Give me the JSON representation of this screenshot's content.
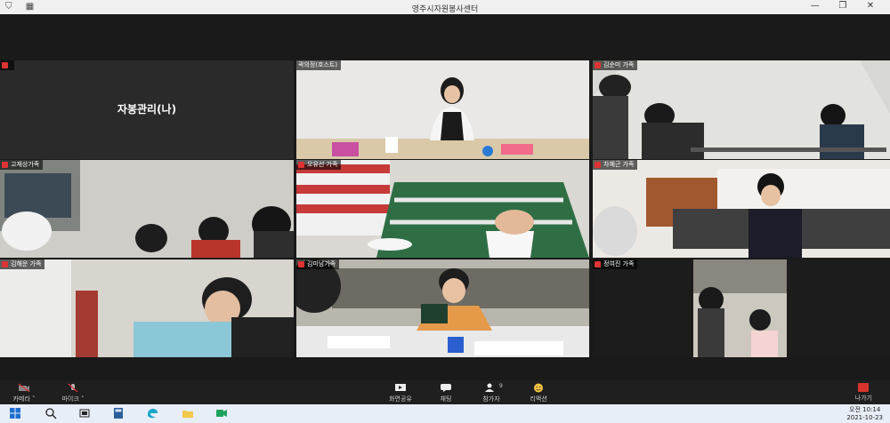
{
  "window": {
    "title": "영주시자원봉사센터"
  },
  "self_tile": {
    "name": "자봉관리(나)"
  },
  "participants": [
    {
      "name": "곽의정(호스트)"
    },
    {
      "name": "김순미 가족"
    },
    {
      "name": "고재상가족"
    },
    {
      "name": "오유선 가족"
    },
    {
      "name": "차혜근 가족"
    },
    {
      "name": "김해운 가족"
    },
    {
      "name": "김미남가족"
    },
    {
      "name": "정여진 가족"
    }
  ],
  "toolbar": {
    "camera_label": "카메라",
    "mic_label": "마이크",
    "share_label": "화면공유",
    "chat_label": "채팅",
    "participants_label": "참가자",
    "participants_count": "9",
    "reaction_label": "리액션",
    "leave_label": "나가기"
  },
  "taskbar": {
    "time": "오전 10:14",
    "date": "2021-10-23"
  },
  "colors": {
    "leave_red": "#d9342b",
    "mute_red": "#dd3333",
    "background": "#1a1a1a"
  }
}
